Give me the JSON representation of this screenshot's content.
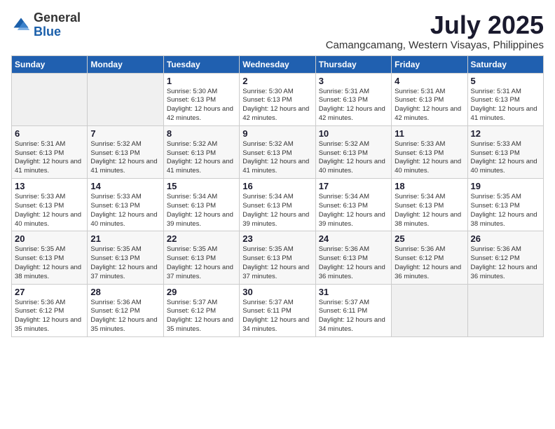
{
  "logo": {
    "text_general": "General",
    "text_blue": "Blue"
  },
  "title": "July 2025",
  "location": "Camangcamang, Western Visayas, Philippines",
  "days_of_week": [
    "Sunday",
    "Monday",
    "Tuesday",
    "Wednesday",
    "Thursday",
    "Friday",
    "Saturday"
  ],
  "weeks": [
    [
      {
        "day": "",
        "sunrise": "",
        "sunset": "",
        "daylight": ""
      },
      {
        "day": "",
        "sunrise": "",
        "sunset": "",
        "daylight": ""
      },
      {
        "day": "1",
        "sunrise": "Sunrise: 5:30 AM",
        "sunset": "Sunset: 6:13 PM",
        "daylight": "Daylight: 12 hours and 42 minutes."
      },
      {
        "day": "2",
        "sunrise": "Sunrise: 5:30 AM",
        "sunset": "Sunset: 6:13 PM",
        "daylight": "Daylight: 12 hours and 42 minutes."
      },
      {
        "day": "3",
        "sunrise": "Sunrise: 5:31 AM",
        "sunset": "Sunset: 6:13 PM",
        "daylight": "Daylight: 12 hours and 42 minutes."
      },
      {
        "day": "4",
        "sunrise": "Sunrise: 5:31 AM",
        "sunset": "Sunset: 6:13 PM",
        "daylight": "Daylight: 12 hours and 42 minutes."
      },
      {
        "day": "5",
        "sunrise": "Sunrise: 5:31 AM",
        "sunset": "Sunset: 6:13 PM",
        "daylight": "Daylight: 12 hours and 41 minutes."
      }
    ],
    [
      {
        "day": "6",
        "sunrise": "Sunrise: 5:31 AM",
        "sunset": "Sunset: 6:13 PM",
        "daylight": "Daylight: 12 hours and 41 minutes."
      },
      {
        "day": "7",
        "sunrise": "Sunrise: 5:32 AM",
        "sunset": "Sunset: 6:13 PM",
        "daylight": "Daylight: 12 hours and 41 minutes."
      },
      {
        "day": "8",
        "sunrise": "Sunrise: 5:32 AM",
        "sunset": "Sunset: 6:13 PM",
        "daylight": "Daylight: 12 hours and 41 minutes."
      },
      {
        "day": "9",
        "sunrise": "Sunrise: 5:32 AM",
        "sunset": "Sunset: 6:13 PM",
        "daylight": "Daylight: 12 hours and 41 minutes."
      },
      {
        "day": "10",
        "sunrise": "Sunrise: 5:32 AM",
        "sunset": "Sunset: 6:13 PM",
        "daylight": "Daylight: 12 hours and 40 minutes."
      },
      {
        "day": "11",
        "sunrise": "Sunrise: 5:33 AM",
        "sunset": "Sunset: 6:13 PM",
        "daylight": "Daylight: 12 hours and 40 minutes."
      },
      {
        "day": "12",
        "sunrise": "Sunrise: 5:33 AM",
        "sunset": "Sunset: 6:13 PM",
        "daylight": "Daylight: 12 hours and 40 minutes."
      }
    ],
    [
      {
        "day": "13",
        "sunrise": "Sunrise: 5:33 AM",
        "sunset": "Sunset: 6:13 PM",
        "daylight": "Daylight: 12 hours and 40 minutes."
      },
      {
        "day": "14",
        "sunrise": "Sunrise: 5:33 AM",
        "sunset": "Sunset: 6:13 PM",
        "daylight": "Daylight: 12 hours and 40 minutes."
      },
      {
        "day": "15",
        "sunrise": "Sunrise: 5:34 AM",
        "sunset": "Sunset: 6:13 PM",
        "daylight": "Daylight: 12 hours and 39 minutes."
      },
      {
        "day": "16",
        "sunrise": "Sunrise: 5:34 AM",
        "sunset": "Sunset: 6:13 PM",
        "daylight": "Daylight: 12 hours and 39 minutes."
      },
      {
        "day": "17",
        "sunrise": "Sunrise: 5:34 AM",
        "sunset": "Sunset: 6:13 PM",
        "daylight": "Daylight: 12 hours and 39 minutes."
      },
      {
        "day": "18",
        "sunrise": "Sunrise: 5:34 AM",
        "sunset": "Sunset: 6:13 PM",
        "daylight": "Daylight: 12 hours and 38 minutes."
      },
      {
        "day": "19",
        "sunrise": "Sunrise: 5:35 AM",
        "sunset": "Sunset: 6:13 PM",
        "daylight": "Daylight: 12 hours and 38 minutes."
      }
    ],
    [
      {
        "day": "20",
        "sunrise": "Sunrise: 5:35 AM",
        "sunset": "Sunset: 6:13 PM",
        "daylight": "Daylight: 12 hours and 38 minutes."
      },
      {
        "day": "21",
        "sunrise": "Sunrise: 5:35 AM",
        "sunset": "Sunset: 6:13 PM",
        "daylight": "Daylight: 12 hours and 37 minutes."
      },
      {
        "day": "22",
        "sunrise": "Sunrise: 5:35 AM",
        "sunset": "Sunset: 6:13 PM",
        "daylight": "Daylight: 12 hours and 37 minutes."
      },
      {
        "day": "23",
        "sunrise": "Sunrise: 5:35 AM",
        "sunset": "Sunset: 6:13 PM",
        "daylight": "Daylight: 12 hours and 37 minutes."
      },
      {
        "day": "24",
        "sunrise": "Sunrise: 5:36 AM",
        "sunset": "Sunset: 6:13 PM",
        "daylight": "Daylight: 12 hours and 36 minutes."
      },
      {
        "day": "25",
        "sunrise": "Sunrise: 5:36 AM",
        "sunset": "Sunset: 6:12 PM",
        "daylight": "Daylight: 12 hours and 36 minutes."
      },
      {
        "day": "26",
        "sunrise": "Sunrise: 5:36 AM",
        "sunset": "Sunset: 6:12 PM",
        "daylight": "Daylight: 12 hours and 36 minutes."
      }
    ],
    [
      {
        "day": "27",
        "sunrise": "Sunrise: 5:36 AM",
        "sunset": "Sunset: 6:12 PM",
        "daylight": "Daylight: 12 hours and 35 minutes."
      },
      {
        "day": "28",
        "sunrise": "Sunrise: 5:36 AM",
        "sunset": "Sunset: 6:12 PM",
        "daylight": "Daylight: 12 hours and 35 minutes."
      },
      {
        "day": "29",
        "sunrise": "Sunrise: 5:37 AM",
        "sunset": "Sunset: 6:12 PM",
        "daylight": "Daylight: 12 hours and 35 minutes."
      },
      {
        "day": "30",
        "sunrise": "Sunrise: 5:37 AM",
        "sunset": "Sunset: 6:11 PM",
        "daylight": "Daylight: 12 hours and 34 minutes."
      },
      {
        "day": "31",
        "sunrise": "Sunrise: 5:37 AM",
        "sunset": "Sunset: 6:11 PM",
        "daylight": "Daylight: 12 hours and 34 minutes."
      },
      {
        "day": "",
        "sunrise": "",
        "sunset": "",
        "daylight": ""
      },
      {
        "day": "",
        "sunrise": "",
        "sunset": "",
        "daylight": ""
      }
    ]
  ]
}
